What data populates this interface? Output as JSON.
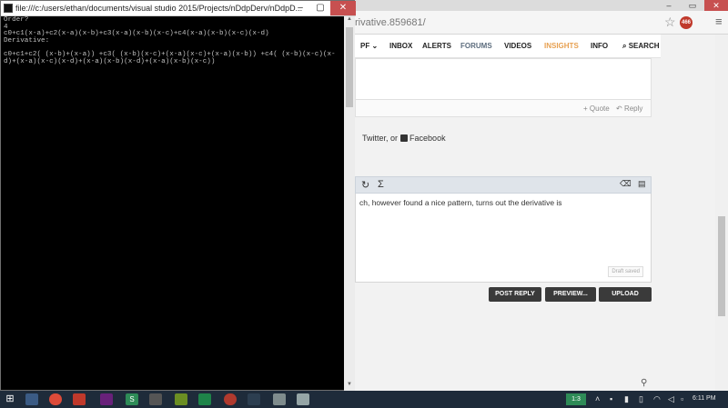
{
  "console": {
    "title": "file:///c:/users/ethan/documents/visual studio 2015/Projects/nDdpDerv/nDdpD...",
    "output": "Order?\n4\nc0+c1(x-a)+c2(x-a)(x-b)+c3(x-a)(x-b)(x-c)+c4(x-a)(x-b)(x-c)(x-d)\nDerivative:\n\nc0+c1+c2( (x-b)+(x-a)) +c3( (x-b)(x-c)+(x-a)(x-c)+(x-a)(x-b)) +c4( (x-b)(x-c)(x-\nd)+(x-a)(x-c)(x-d)+(x-a)(x-b)(x-d)+(x-a)(x-b)(x-c))"
  },
  "browser": {
    "url": "rivative.859681/",
    "ext_badge": "466",
    "nav": {
      "pf": "PF",
      "inbox": "INBOX",
      "alerts": "ALERTS",
      "forums": "FORUMS",
      "videos": "VIDEOS",
      "insights": "INSIGHTS",
      "info": "INFO",
      "search": "SEARCH"
    },
    "post": {
      "quote": "+ Quote",
      "reply": "Reply"
    },
    "share_text": "Twitter, or",
    "share_facebook": "Facebook",
    "editor_text": "ch, however found a nice pattern, turns out the derivative is",
    "draft_saved": "Draft saved",
    "buttons": {
      "post_reply": "POST REPLY",
      "preview": "PREVIEW...",
      "upload": "UPLOAD"
    }
  },
  "taskbar": {
    "tray_tag": "1:3",
    "time": "6:11 PM"
  },
  "colors": {
    "console_bg": "#000000",
    "console_text": "#c0c0c0",
    "taskbar": "#1e2b3a",
    "insights": "#e7a050",
    "close": "#c75050"
  }
}
